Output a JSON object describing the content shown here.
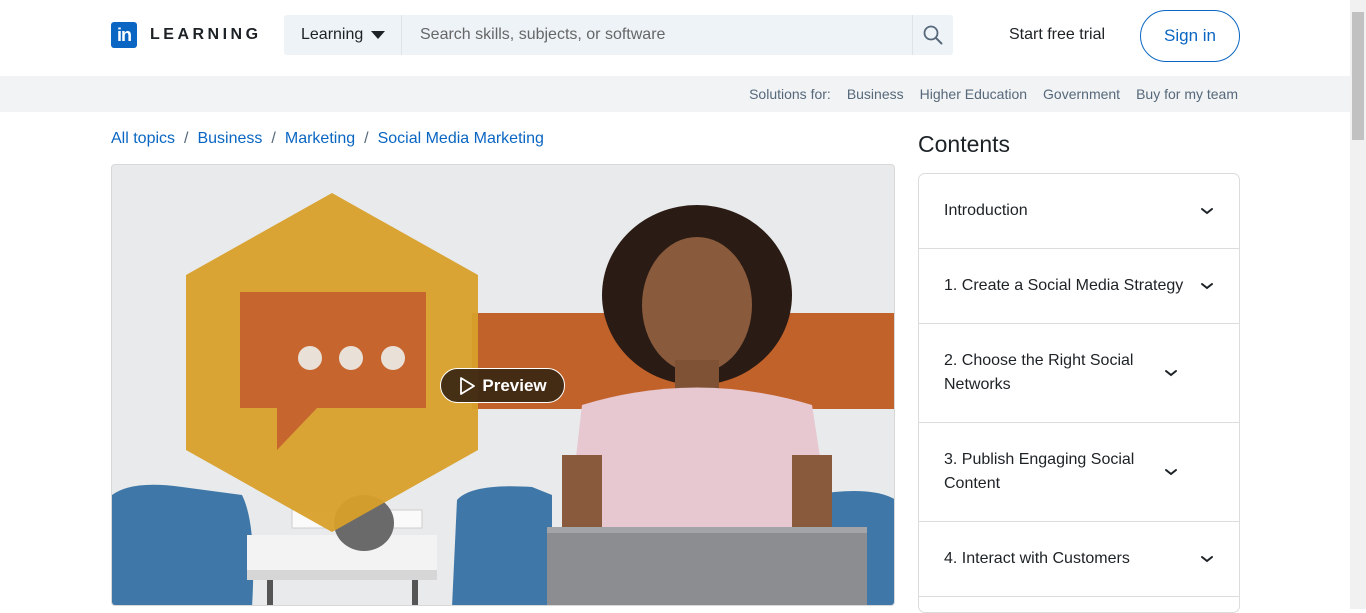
{
  "brand": {
    "logo_letters": "in",
    "name": "LEARNING",
    "color": "#0a66c2"
  },
  "search": {
    "category": "Learning",
    "placeholder": "Search skills, subjects, or software"
  },
  "header": {
    "trial": "Start free trial",
    "signin": "Sign in"
  },
  "solutions": {
    "label": "Solutions for:",
    "items": [
      "Business",
      "Higher Education",
      "Government",
      "Buy for my team"
    ]
  },
  "breadcrumb": [
    "All topics",
    "Business",
    "Marketing",
    "Social Media Marketing"
  ],
  "video": {
    "preview_label": "Preview"
  },
  "contents": {
    "title": "Contents",
    "sections": [
      "Introduction",
      "1. Create a Social Media Strategy",
      "2. Choose the Right Social Networks",
      "3. Publish Engaging Social Content",
      "4. Interact with Customers"
    ]
  }
}
